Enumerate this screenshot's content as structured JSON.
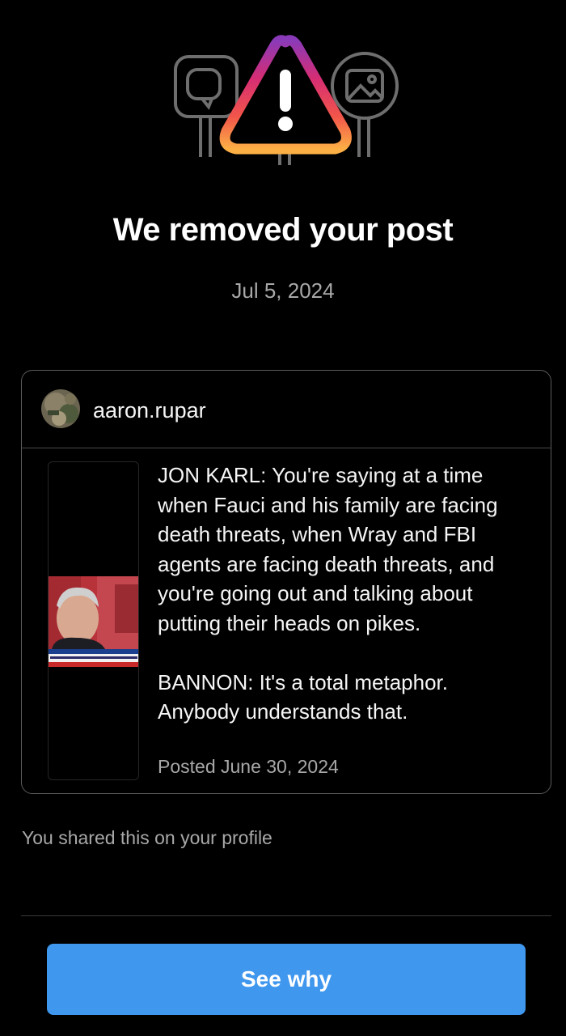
{
  "notice": {
    "title": "We removed your post",
    "date": "Jul 5, 2024"
  },
  "post": {
    "username": "aaron.rupar",
    "text": "JON KARL: You're saying at a time when Fauci and his family are facing death threats, when Wray and FBI agents are facing death threats, and you're going out and talking about putting their heads on pikes.\n\nBANNON: It's a total metaphor. Anybody understands that.",
    "posted": "Posted June 30, 2024"
  },
  "shared_note": "You shared this on your profile",
  "actions": {
    "see_why_label": "See why"
  },
  "icons": {
    "hero": "warning-triangle-icon",
    "left_sign": "speech-bubble-icon",
    "right_sign": "image-icon"
  },
  "colors": {
    "button": "#3f97ee",
    "muted_text": "#a8a8a8",
    "gradient": [
      "#8a3ab9",
      "#e1306c",
      "#f56040",
      "#fcaf45"
    ]
  }
}
